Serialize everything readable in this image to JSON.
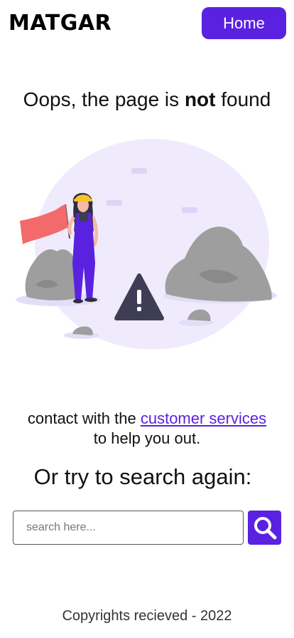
{
  "header": {
    "logo": "MATGAR",
    "home_label": "Home"
  },
  "main": {
    "headline_prefix": "Oops, the page is ",
    "headline_bold": "not",
    "headline_suffix": " found",
    "contact_prefix": "contact with the ",
    "contact_link": "customer services",
    "contact_suffix": "to help you out.",
    "retry": "Or try to search again:"
  },
  "search": {
    "placeholder": "search here..."
  },
  "footer": {
    "text": "Copyrights recieved - 2022"
  },
  "icons": {
    "search": "search-icon",
    "warning": "warning-icon",
    "flag": "flag-icon"
  },
  "colors": {
    "accent": "#5a22e0",
    "blob": "#efebfc",
    "flag": "#f26a6a",
    "rock": "#9e9e9e",
    "warning": "#3f3d56"
  }
}
